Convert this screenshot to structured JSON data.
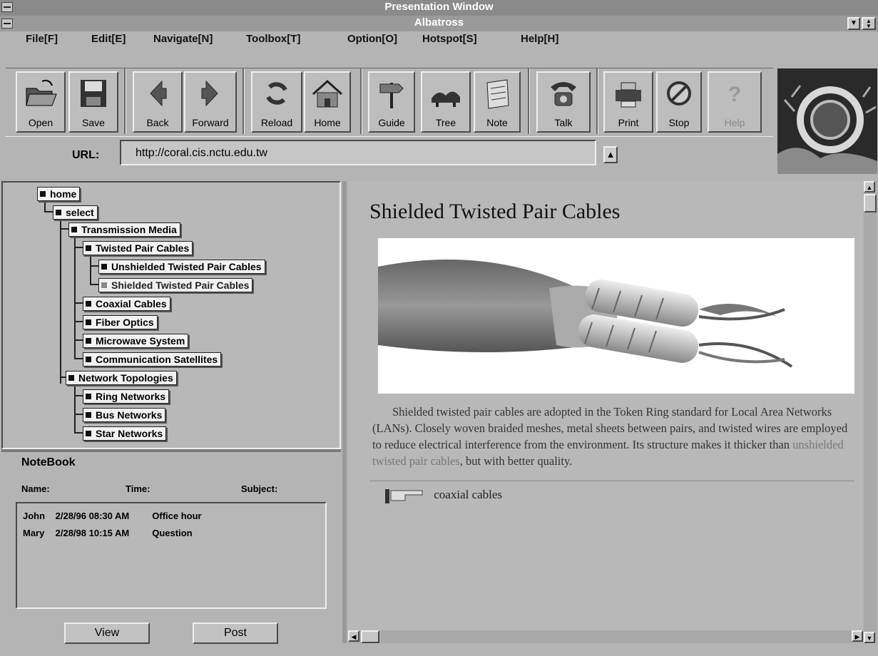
{
  "window": {
    "outer_title": "Presentation Window",
    "inner_title": "Albatross"
  },
  "menu": [
    "File[F]",
    "Edit[E]",
    "Navigate[N]",
    "Toolbox[T]",
    "Option[O]",
    "Hotspot[S]",
    "Help[H]"
  ],
  "toolbar": {
    "open": "Open",
    "save": "Save",
    "back": "Back",
    "forward": "Forward",
    "reload": "Reload",
    "home": "Home",
    "guide": "Guide",
    "tree": "Tree",
    "note": "Note",
    "talk": "Talk",
    "print": "Print",
    "stop": "Stop",
    "help": "Help"
  },
  "url": {
    "label": "URL:",
    "value": "http://coral.cis.nctu.edu.tw"
  },
  "tree": {
    "home": "home",
    "select": "select",
    "transmission_media": "Transmission Media",
    "twisted_pair": "Twisted Pair Cables",
    "unshielded": "Unshielded Twisted Pair Cables",
    "shielded": "Shielded Twisted Pair Cables",
    "coaxial": "Coaxial Cables",
    "fiber": "Fiber Optics",
    "microwave": "Microwave System",
    "satellites": "Communication Satellites",
    "topologies": "Network Topologies",
    "ring": "Ring Networks",
    "bus": "Bus Networks",
    "star": "Star Networks"
  },
  "notebook": {
    "title": "NoteBook",
    "headers": {
      "name": "Name:",
      "time": "Time:",
      "subject": "Subject:"
    },
    "rows": [
      {
        "name": "John",
        "time": "2/28/96 08:30 AM",
        "subject": "Office hour"
      },
      {
        "name": "Mary",
        "time": "2/28/98 10:15 AM",
        "subject": "Question"
      }
    ],
    "view": "View",
    "post": "Post"
  },
  "content": {
    "title": "Shielded Twisted Pair Cables",
    "para_before": "Shielded twisted pair cables are adopted in the Token Ring standard for Local Area Networks (LANs). Closely woven braided meshes, metal sheets between pairs, and twisted wires are employed to reduce electrical interference from the environment. Its structure makes it thicker than ",
    "para_link": "unshielded twisted pair cables",
    "para_after": ", but with better quality.",
    "next_link": "coaxial cables"
  }
}
